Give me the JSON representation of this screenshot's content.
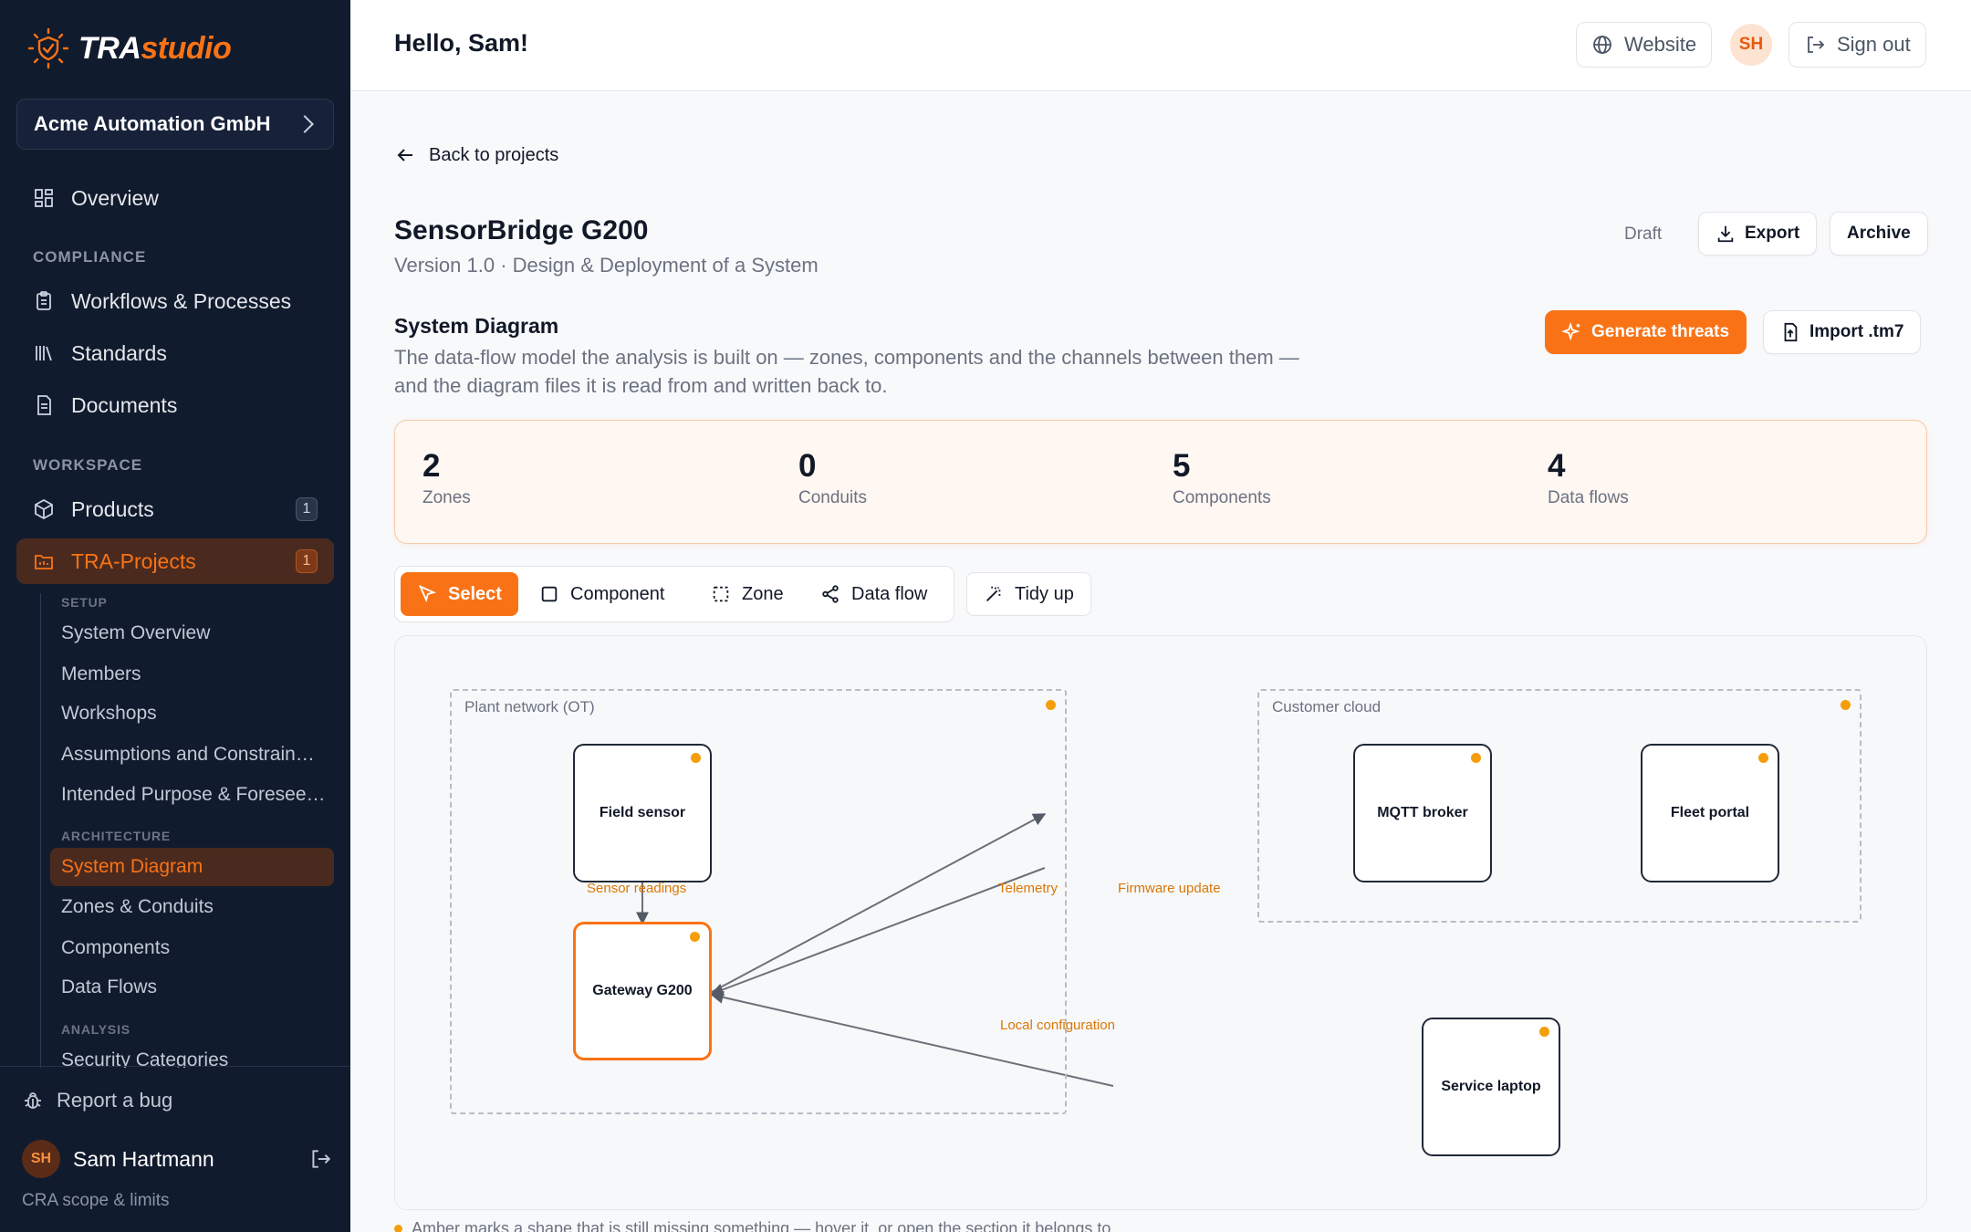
{
  "app": {
    "logo_prefix": "TRA",
    "logo_suffix": "studio",
    "accent_color": "#f97316",
    "sidebar_bg": "#111b2e"
  },
  "sidebar": {
    "org_name": "Acme Automation GmbH",
    "overview": "Overview",
    "compliance_label": "COMPLIANCE",
    "compliance_items": [
      "Workflows & Processes",
      "Standards",
      "Documents"
    ],
    "workspace_label": "WORKSPACE",
    "products": {
      "label": "Products",
      "count": "1"
    },
    "tra_projects": {
      "label": "TRA-Projects",
      "count": "1"
    },
    "setup_label": "SETUP",
    "setup_items": [
      "System Overview",
      "Members",
      "Workshops",
      "Assumptions and Constrain…",
      "Intended Purpose & Foresee…"
    ],
    "architecture_label": "ARCHITECTURE",
    "architecture_items": [
      "System Diagram",
      "Zones & Conduits",
      "Components",
      "Data Flows"
    ],
    "analysis_label": "ANALYSIS",
    "analysis_items": [
      "Security Categories"
    ],
    "report_bug": "Report a bug",
    "user_initials": "SH",
    "user_name": "Sam Hartmann",
    "cra_link": "CRA scope & limits"
  },
  "topbar": {
    "greeting": "Hello, Sam!",
    "website": "Website",
    "avatar_initials": "SH",
    "sign_out": "Sign out"
  },
  "project": {
    "back": "Back to projects",
    "title": "SensorBridge G200",
    "subtitle": "Version 1.0 · Design & Deployment of a System",
    "status": "Draft",
    "export": "Export",
    "archive": "Archive"
  },
  "diagram_section": {
    "title": "System Diagram",
    "description": "The data-flow model the analysis is built on — zones, components and the channels between them — and the diagram files it is read from and written back to.",
    "generate": "Generate threats",
    "import": "Import .tm7"
  },
  "stats": [
    {
      "value": "2",
      "label": "Zones"
    },
    {
      "value": "0",
      "label": "Conduits"
    },
    {
      "value": "5",
      "label": "Components"
    },
    {
      "value": "4",
      "label": "Data flows"
    }
  ],
  "toolbar": {
    "select": "Select",
    "component": "Component",
    "zone": "Zone",
    "data_flow": "Data flow",
    "tidy": "Tidy up"
  },
  "diagram": {
    "zones": [
      {
        "label": "Plant network (OT)"
      },
      {
        "label": "Customer cloud"
      }
    ],
    "components": [
      {
        "label": "Field sensor"
      },
      {
        "label": "Gateway G200"
      },
      {
        "label": "MQTT broker"
      },
      {
        "label": "Fleet portal"
      },
      {
        "label": "Service laptop"
      }
    ],
    "flows": [
      {
        "label": "Sensor readings"
      },
      {
        "label": "Telemetry"
      },
      {
        "label": "Firmware update"
      },
      {
        "label": "Local configuration"
      }
    ],
    "warning_color": "#f59e0b"
  },
  "footer_note": "Amber marks a shape that is still missing something — hover it, or open the section it belongs to."
}
